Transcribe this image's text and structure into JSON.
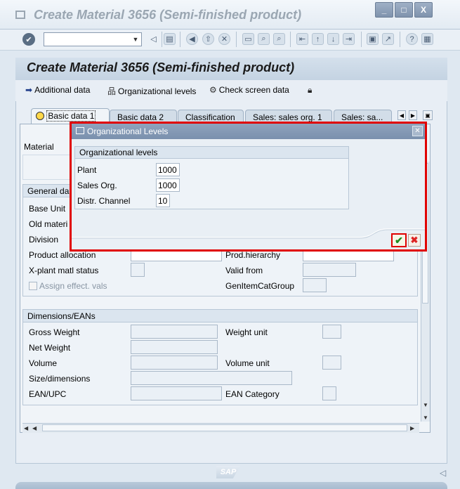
{
  "window": {
    "title": "Create Material 3656 (Semi-finished product)",
    "controls": [
      "_",
      "□",
      "X"
    ]
  },
  "toolbar": {
    "command_field_value": "",
    "icons": [
      "enter-icon",
      "dropdown-icon",
      "back-arrow-icon",
      "save-icon",
      "back-icon",
      "exit-icon",
      "cancel-icon",
      "print-icon",
      "find-icon",
      "find-next-icon",
      "first-page-icon",
      "prev-page-icon",
      "next-page-icon",
      "last-page-icon",
      "new-session-icon",
      "shortcut-icon",
      "help-icon",
      "customize-layout-icon"
    ]
  },
  "page": {
    "title": "Create Material 3656 (Semi-finished product)",
    "actions": [
      {
        "label": "Additional data",
        "icon": "arrow-right-icon"
      },
      {
        "label": "Organizational levels",
        "icon": "org-levels-icon"
      },
      {
        "label": "Check screen data",
        "icon": "check-screen-icon"
      },
      {
        "label": "",
        "icon": "lock-icon"
      }
    ],
    "tabs": [
      {
        "label": "Basic data 1",
        "active": true
      },
      {
        "label": "Basic data 2",
        "active": false
      },
      {
        "label": "Classification",
        "active": false
      },
      {
        "label": "Sales: sales org. 1",
        "active": false
      },
      {
        "label": "Sales: sa...",
        "active": false
      }
    ]
  },
  "form": {
    "material_label": "Material",
    "general_data": {
      "header": "General da",
      "labels": {
        "base_unit": "Base Unit",
        "old_material": "Old materi",
        "division": "Division",
        "product_allocation": "Product allocation",
        "prod_hierarchy": "Prod.hierarchy",
        "xplant_status": "X-plant matl status",
        "valid_from": "Valid from",
        "assign_effect": "Assign effect. vals",
        "gen_item_cat": "GenItemCatGroup"
      }
    },
    "dimensions": {
      "header": "Dimensions/EANs",
      "labels": {
        "gross_weight": "Gross Weight",
        "weight_unit": "Weight unit",
        "net_weight": "Net Weight",
        "volume": "Volume",
        "volume_unit": "Volume unit",
        "size_dimensions": "Size/dimensions",
        "ean_upc": "EAN/UPC",
        "ean_category": "EAN Category"
      }
    }
  },
  "dialog": {
    "title": "Organizational Levels",
    "group_header": "Organizational levels",
    "fields": [
      {
        "label": "Plant",
        "value": "1000"
      },
      {
        "label": "Sales Org.",
        "value": "1000"
      },
      {
        "label": "Distr. Channel",
        "value": "10"
      }
    ]
  },
  "footer": {
    "logo_text": "SAP"
  }
}
